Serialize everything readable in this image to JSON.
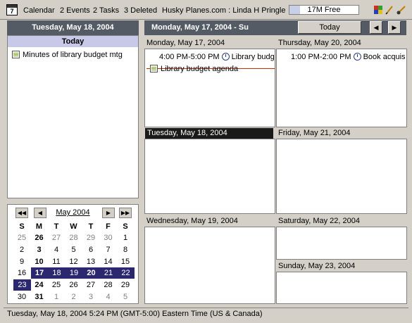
{
  "topbar": {
    "app_icon_text": "7",
    "app_name": "Calendar",
    "events": "2 Events",
    "tasks": "2 Tasks",
    "deleted": "3 Deleted",
    "account": "Husky Planes.com : Linda H Pringle",
    "memory_label": "17M Free",
    "memory_used_fraction": 0.15,
    "icons": [
      "windows-icon",
      "pencil-icon",
      "brush-icon"
    ]
  },
  "left": {
    "date_header": "Tuesday, May 18, 2004",
    "today_title": "Today",
    "tasks": [
      {
        "label": "Minutes of library budget mtg"
      }
    ]
  },
  "mini_cal": {
    "month_label": "May 2004",
    "weekdays": [
      "S",
      "M",
      "T",
      "W",
      "T",
      "F",
      "S"
    ],
    "weeks": [
      [
        {
          "d": "25",
          "g": 1
        },
        {
          "d": "26",
          "b": 1
        },
        {
          "d": "27",
          "g": 1
        },
        {
          "d": "28",
          "g": 1
        },
        {
          "d": "29",
          "g": 1
        },
        {
          "d": "30",
          "g": 1
        },
        {
          "d": "1"
        }
      ],
      [
        {
          "d": "2"
        },
        {
          "d": "3",
          "b": 1
        },
        {
          "d": "4"
        },
        {
          "d": "5"
        },
        {
          "d": "6"
        },
        {
          "d": "7"
        },
        {
          "d": "8"
        }
      ],
      [
        {
          "d": "9"
        },
        {
          "d": "10",
          "b": 1
        },
        {
          "d": "11"
        },
        {
          "d": "12"
        },
        {
          "d": "13"
        },
        {
          "d": "14"
        },
        {
          "d": "15"
        }
      ],
      [
        {
          "d": "16"
        },
        {
          "d": "17",
          "b": 1,
          "s": 1
        },
        {
          "d": "18",
          "s": 1
        },
        {
          "d": "19",
          "s": 1
        },
        {
          "d": "20",
          "b": 1,
          "s": 1
        },
        {
          "d": "21",
          "s": 1
        },
        {
          "d": "22",
          "s": 1
        }
      ],
      [
        {
          "d": "23",
          "s": 1
        },
        {
          "d": "24",
          "b": 1
        },
        {
          "d": "25"
        },
        {
          "d": "26"
        },
        {
          "d": "27"
        },
        {
          "d": "28"
        },
        {
          "d": "29"
        }
      ],
      [
        {
          "d": "30"
        },
        {
          "d": "31",
          "b": 1
        },
        {
          "d": "1",
          "g": 1
        },
        {
          "d": "2",
          "g": 1
        },
        {
          "d": "3",
          "g": 1
        },
        {
          "d": "4",
          "g": 1
        },
        {
          "d": "5",
          "g": 1
        }
      ]
    ]
  },
  "week": {
    "range_title": "Monday, May 17, 2004 - Su",
    "today_button": "Today",
    "days": {
      "mon": {
        "header": "Monday, May 17, 2004",
        "event_time": "4:00 PM-5:00 PM",
        "event_title": "Library budg",
        "task": "Library budget agenda"
      },
      "thu": {
        "header": "Thursday, May 20, 2004",
        "event_time": "1:00 PM-2:00 PM",
        "event_title": "Book acquis"
      },
      "tue": {
        "header": "Tuesday, May 18, 2004"
      },
      "fri": {
        "header": "Friday, May 21, 2004"
      },
      "wed": {
        "header": "Wednesday, May 19, 2004"
      },
      "sat": {
        "header": "Saturday, May 22, 2004"
      },
      "sun": {
        "header": "Sunday, May 23, 2004"
      }
    }
  },
  "status": {
    "text": "Tuesday, May 18, 2004 5:24 PM (GMT-5:00) Eastern Time (US & Canada)"
  },
  "colors": {
    "header_bg": "#545b65",
    "selected_week": "#2c2870",
    "active_day": "#1a1a1a",
    "strike": "#c03000"
  }
}
